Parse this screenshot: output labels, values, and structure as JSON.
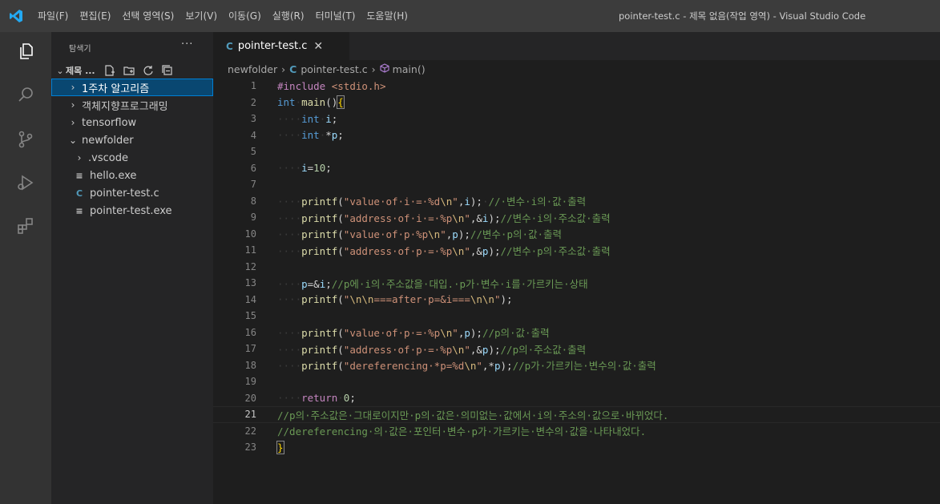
{
  "colors": {
    "accent": "#007acc",
    "selection": "#094771",
    "c_icon": "#519aba"
  },
  "titlebar": {
    "menu": [
      "파일(F)",
      "편집(E)",
      "선택 영역(S)",
      "보기(V)",
      "이동(G)",
      "실행(R)",
      "터미널(T)",
      "도움말(H)"
    ],
    "title": "pointer-test.c - 제목 없음(작업 영역) - Visual Studio Code"
  },
  "activitybar": {
    "icons": [
      "explorer-icon",
      "search-icon",
      "source-control-icon",
      "run-debug-icon",
      "extensions-icon"
    ]
  },
  "sidebar": {
    "title": "탐색기",
    "more": "···",
    "section": "제목 ...",
    "items": [
      {
        "label": "1주차 알고리즘",
        "twisty": "›",
        "icon": ""
      },
      {
        "label": "객체지향프로그래밍",
        "twisty": "›",
        "icon": ""
      },
      {
        "label": "tensorflow",
        "twisty": "›",
        "icon": ""
      },
      {
        "label": "newfolder",
        "twisty": "⌄",
        "icon": ""
      },
      {
        "label": ".vscode",
        "twisty": "›",
        "icon": ""
      },
      {
        "label": "hello.exe",
        "twisty": "",
        "icon": "≡"
      },
      {
        "label": "pointer-test.c",
        "twisty": "",
        "icon": "C"
      },
      {
        "label": "pointer-test.exe",
        "twisty": "",
        "icon": "≡"
      }
    ]
  },
  "editor": {
    "tab": {
      "icon": "C",
      "label": "pointer-test.c",
      "close": "✕"
    },
    "breadcrumb": {
      "folder": "newfolder",
      "file_icon": "C",
      "file": "pointer-test.c",
      "symbol": "main()"
    },
    "current_line": 21,
    "line_numbers": [
      "1",
      "2",
      "3",
      "4",
      "5",
      "6",
      "7",
      "8",
      "9",
      "10",
      "11",
      "12",
      "13",
      "14",
      "15",
      "16",
      "17",
      "18",
      "19",
      "20",
      "21",
      "22",
      "23"
    ]
  }
}
